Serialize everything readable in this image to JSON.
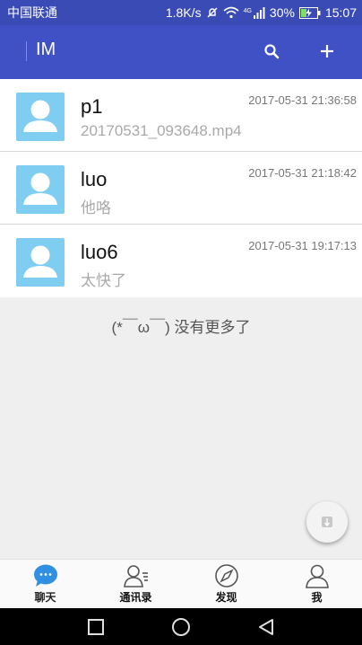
{
  "status_bar": {
    "carrier": "中国联通",
    "speed": "1.8K/s",
    "network": "4G",
    "battery": "30%",
    "time": "15:07"
  },
  "app_bar": {
    "title": "IM"
  },
  "conversations": [
    {
      "name": "p1",
      "preview": "20170531_093648.mp4",
      "time": "2017-05-31 21:36:58"
    },
    {
      "name": "luo",
      "preview": "他咯",
      "time": "2017-05-31 21:18:42"
    },
    {
      "name": "luo6",
      "preview": "太快了",
      "time": "2017-05-31 19:17:13"
    }
  ],
  "list_footer": "(*￣ω￣) 没有更多了",
  "tabs": [
    {
      "label": "聊天",
      "icon": "chat-bubble-icon",
      "active": true
    },
    {
      "label": "通讯录",
      "icon": "contacts-icon",
      "active": false
    },
    {
      "label": "发现",
      "icon": "compass-icon",
      "active": false
    },
    {
      "label": "我",
      "icon": "person-icon",
      "active": false
    }
  ],
  "colors": {
    "status_bar": "#3a4bb6",
    "app_bar": "#3f51c5",
    "avatar": "#7fcdf0",
    "active_tab": "#2f8fe0"
  }
}
